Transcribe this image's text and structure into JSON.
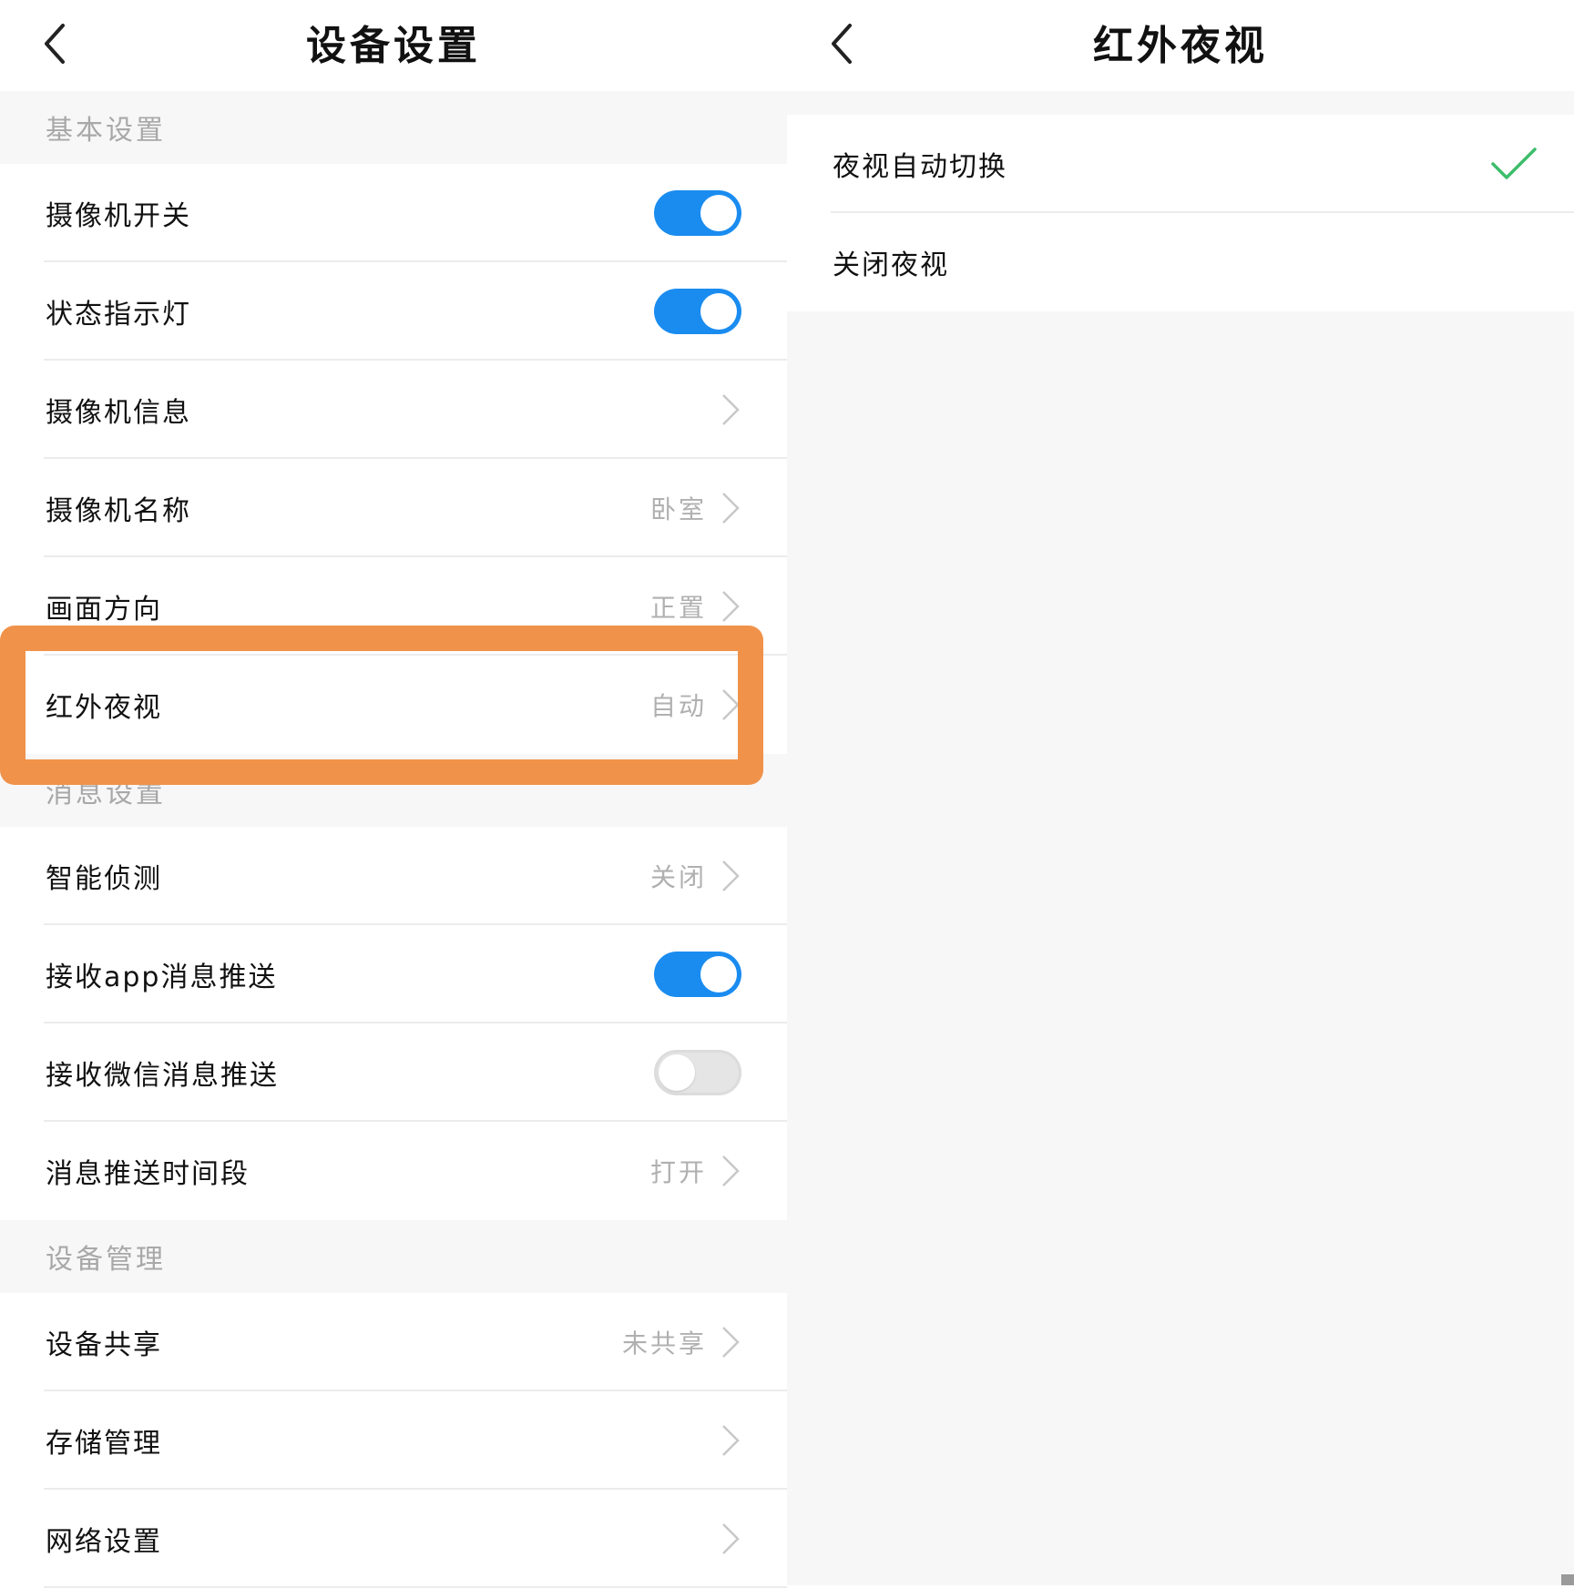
{
  "left": {
    "title": "设备设置",
    "sections": [
      {
        "header": "基本设置",
        "rows": [
          {
            "label": "摄像机开关",
            "toggle": "on"
          },
          {
            "label": "状态指示灯",
            "toggle": "on"
          },
          {
            "label": "摄像机信息",
            "chevron": true
          },
          {
            "label": "摄像机名称",
            "value": "卧室",
            "chevron": true
          },
          {
            "label": "画面方向",
            "value": "正置",
            "chevron": true
          },
          {
            "label": "红外夜视",
            "value": "自动",
            "chevron": true,
            "highlighted": true
          }
        ]
      },
      {
        "header": "消息设置",
        "rows": [
          {
            "label": "智能侦测",
            "value": "关闭",
            "chevron": true
          },
          {
            "label": "接收app消息推送",
            "toggle": "on"
          },
          {
            "label": "接收微信消息推送",
            "toggle": "off"
          },
          {
            "label": "消息推送时间段",
            "value": "打开",
            "chevron": true
          }
        ]
      },
      {
        "header": "设备管理",
        "rows": [
          {
            "label": "设备共享",
            "value": "未共享",
            "chevron": true
          },
          {
            "label": "存储管理",
            "chevron": true
          },
          {
            "label": "网络设置",
            "chevron": true
          }
        ]
      }
    ]
  },
  "right": {
    "title": "红外夜视",
    "options": [
      {
        "label": "夜视自动切换",
        "selected": true
      },
      {
        "label": "关闭夜视",
        "selected": false
      }
    ]
  },
  "colors": {
    "toggle_on": "#1a8cf0",
    "highlight_frame": "#f0924a",
    "check": "#3dbd6a"
  }
}
